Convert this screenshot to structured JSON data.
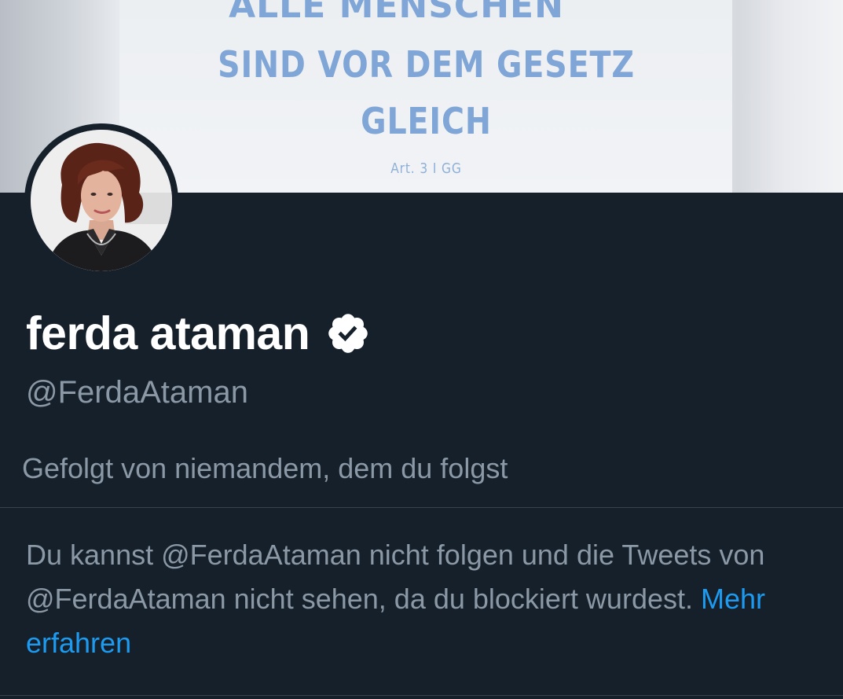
{
  "banner": {
    "line1": "ALLE MENSCHEN",
    "line2": "SIND VOR DEM GESETZ",
    "line3": "GLEICH",
    "caption": "Art. 3 I GG"
  },
  "profile": {
    "display_name": "ferda ataman",
    "verified_icon": "verified-badge-icon",
    "handle": "@FerdaAtaman",
    "followed_by": "Gefolgt von niemandem, dem du folgst"
  },
  "block_notice": {
    "text": "Du kannst @FerdaAtaman nicht folgen und die Tweets von @FerdaAtaman nicht sehen, da du blockiert wurdest.",
    "link_label": "Mehr erfahren"
  },
  "colors": {
    "background": "#15202b",
    "primary_text": "#ffffff",
    "secondary_text": "#8b98a5",
    "link": "#1d9bf0",
    "banner_text": "#7fa6d6"
  }
}
